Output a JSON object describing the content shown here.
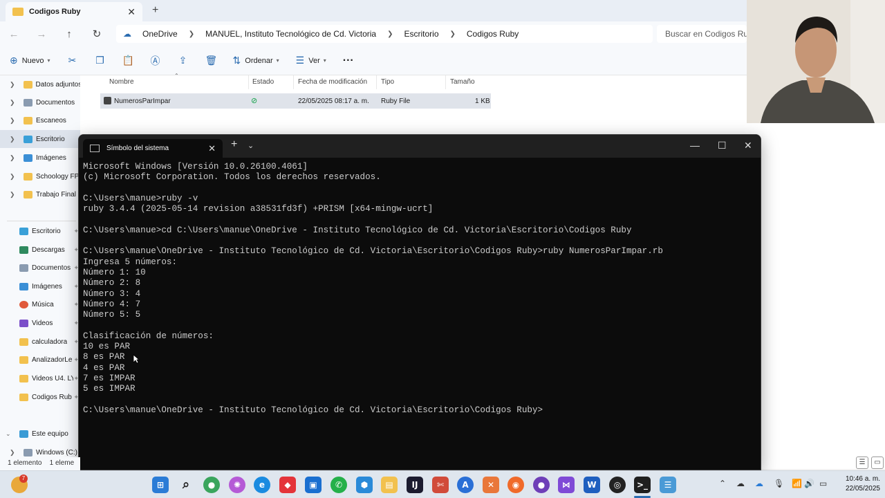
{
  "explorer": {
    "tab_title": "Codigos Ruby",
    "breadcrumb": [
      "OneDrive",
      "MANUEL, Instituto Tecnológico de Cd. Victoria",
      "Escritorio",
      "Codigos Ruby"
    ],
    "search_placeholder": "Buscar en Codigos Ruby",
    "commands": {
      "new": "Nuevo",
      "sort": "Ordenar",
      "view": "Ver",
      "more": "···"
    },
    "columns": {
      "name": "Nombre",
      "status": "Estado",
      "modified": "Fecha de modificación",
      "type": "Tipo",
      "size": "Tamaño"
    },
    "file": {
      "name": "NumerosParImpar",
      "modified": "22/05/2025 08:17 a. m.",
      "type": "Ruby File",
      "size": "1 KB"
    },
    "sidebar_top": [
      "Datos adjuntos",
      "Documentos",
      "Escaneos",
      "Escritorio",
      "Imágenes",
      "Schoology FP",
      "Trabajo Final"
    ],
    "quick_access": [
      "Escritorio",
      "Descargas",
      "Documentos",
      "Imágenes",
      "Música",
      "Videos",
      "calculadora",
      "AnalizadorLe",
      "Videos U4. LY",
      "Codigos Rub"
    ],
    "this_pc": "Este equipo",
    "drive": "Windows (C:)",
    "status_count": "1 elemento",
    "status_count_2": "1 eleme"
  },
  "terminal": {
    "tab_title": "Símbolo del sistema",
    "lines": [
      "Microsoft Windows [Versión 10.0.26100.4061]",
      "(c) Microsoft Corporation. Todos los derechos reservados.",
      "",
      "C:\\Users\\manue>ruby -v",
      "ruby 3.4.4 (2025-05-14 revision a38531fd3f) +PRISM [x64-mingw-ucrt]",
      "",
      "C:\\Users\\manue>cd C:\\Users\\manue\\OneDrive - Instituto Tecnológico de Cd. Victoria\\Escritorio\\Codigos Ruby",
      "",
      "C:\\Users\\manue\\OneDrive - Instituto Tecnológico de Cd. Victoria\\Escritorio\\Codigos Ruby>ruby NumerosParImpar.rb",
      "Ingresa 5 números:",
      "Número 1: 10",
      "Número 2: 8",
      "Número 3: 4",
      "Número 4: 7",
      "Número 5: 5",
      "",
      "Clasificación de números:",
      "10 es PAR",
      "8 es PAR",
      "4 es PAR",
      "7 es IMPAR",
      "5 es IMPAR",
      "",
      "C:\\Users\\manue\\OneDrive - Instituto Tecnológico de Cd. Victoria\\Escritorio\\Codigos Ruby>"
    ]
  },
  "taskbar": {
    "notification_badge": "7",
    "time": "10:46 a. m.",
    "date": "22/05/2025"
  },
  "colors": {
    "folder": "#f2c14e",
    "terminal_bg": "#0c0c0c",
    "terminal_fg": "#cccccc",
    "accent": "#2b6cb0",
    "ok": "#16a34a"
  }
}
